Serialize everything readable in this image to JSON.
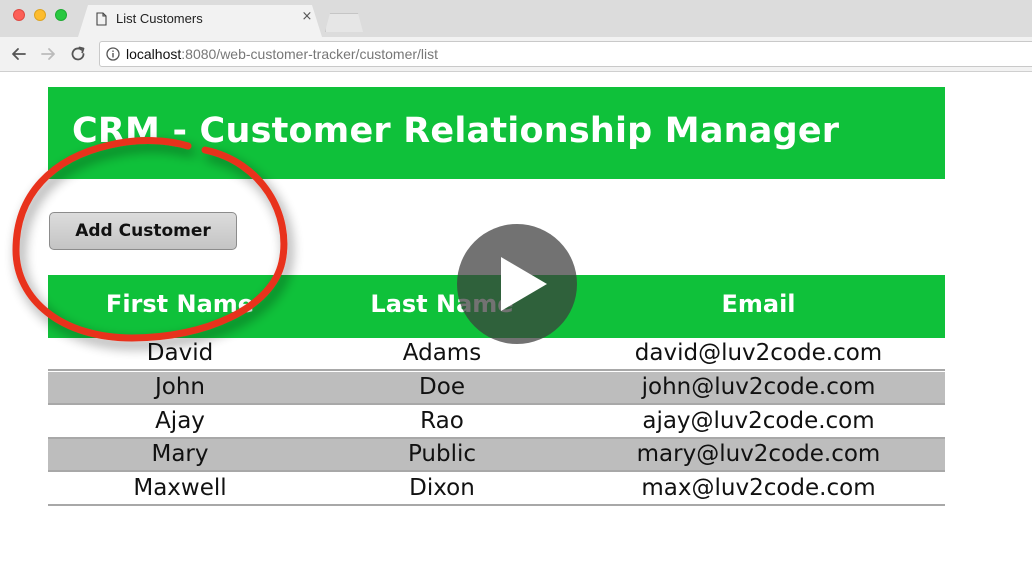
{
  "browser": {
    "tab_title": "List Customers",
    "tab_close_glyph": "×",
    "url_host": "localhost",
    "url_path": ":8080/web-customer-tracker/customer/list",
    "icons": {
      "back": "back-arrow-icon",
      "forward": "forward-arrow-icon",
      "reload": "reload-icon",
      "info": "info-icon",
      "document": "document-icon"
    }
  },
  "page": {
    "header_title": "CRM - Customer Relationship Manager",
    "add_button_label": "Add Customer",
    "table": {
      "columns": [
        "First Name",
        "Last Name",
        "Email"
      ],
      "rows": [
        [
          "David",
          "Adams",
          "david@luv2code.com"
        ],
        [
          "John",
          "Doe",
          "john@luv2code.com"
        ],
        [
          "Ajay",
          "Rao",
          "ajay@luv2code.com"
        ],
        [
          "Mary",
          "Public",
          "mary@luv2code.com"
        ],
        [
          "Maxwell",
          "Dixon",
          "max@luv2code.com"
        ]
      ]
    }
  },
  "colors": {
    "accent_green": "#0fc13a",
    "annotation_red": "#e8321c",
    "row_alt": "#bdbdbd"
  },
  "overlay": {
    "play_icon": "play-icon",
    "annotation": "red-circle-annotation"
  }
}
